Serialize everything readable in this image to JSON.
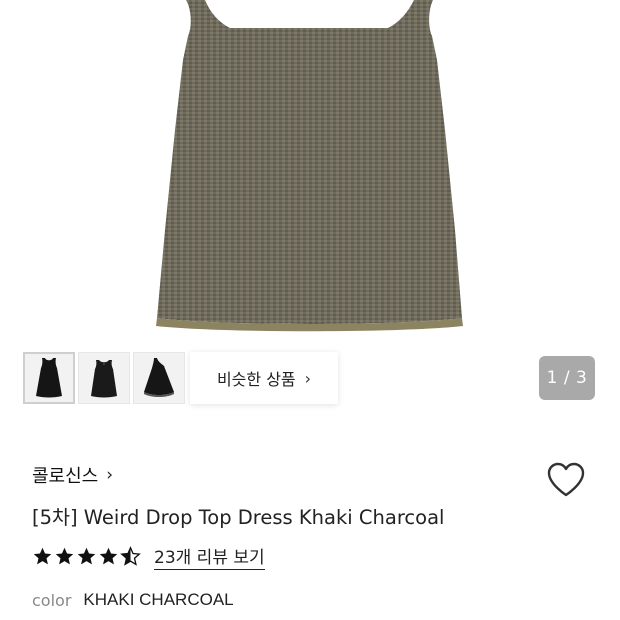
{
  "hero": {
    "image": "product-dress-khaki-charcoal",
    "dress_color": "#6e6a5c",
    "hem_color": "#8c8460"
  },
  "gallery": {
    "thumbnails": [
      {
        "name": "front-view"
      },
      {
        "name": "back-view"
      },
      {
        "name": "side-view"
      }
    ],
    "similar_label": "비슷한 상품",
    "current_page": 1,
    "total_pages": 3,
    "counter_text": "1 / 3"
  },
  "product": {
    "brand": "콜로신스",
    "title": "[5차] Weird Drop Top Dress Khaki Charcoal",
    "rating": 4.5,
    "rating_max": 5,
    "reviews_link": "23개 리뷰 보기",
    "color_label": "color",
    "color_value": "KHAKI CHARCOAL"
  },
  "colors": {
    "star": "#111111",
    "counter_bg": "#a9a9a9",
    "heart_stroke": "#333333"
  }
}
